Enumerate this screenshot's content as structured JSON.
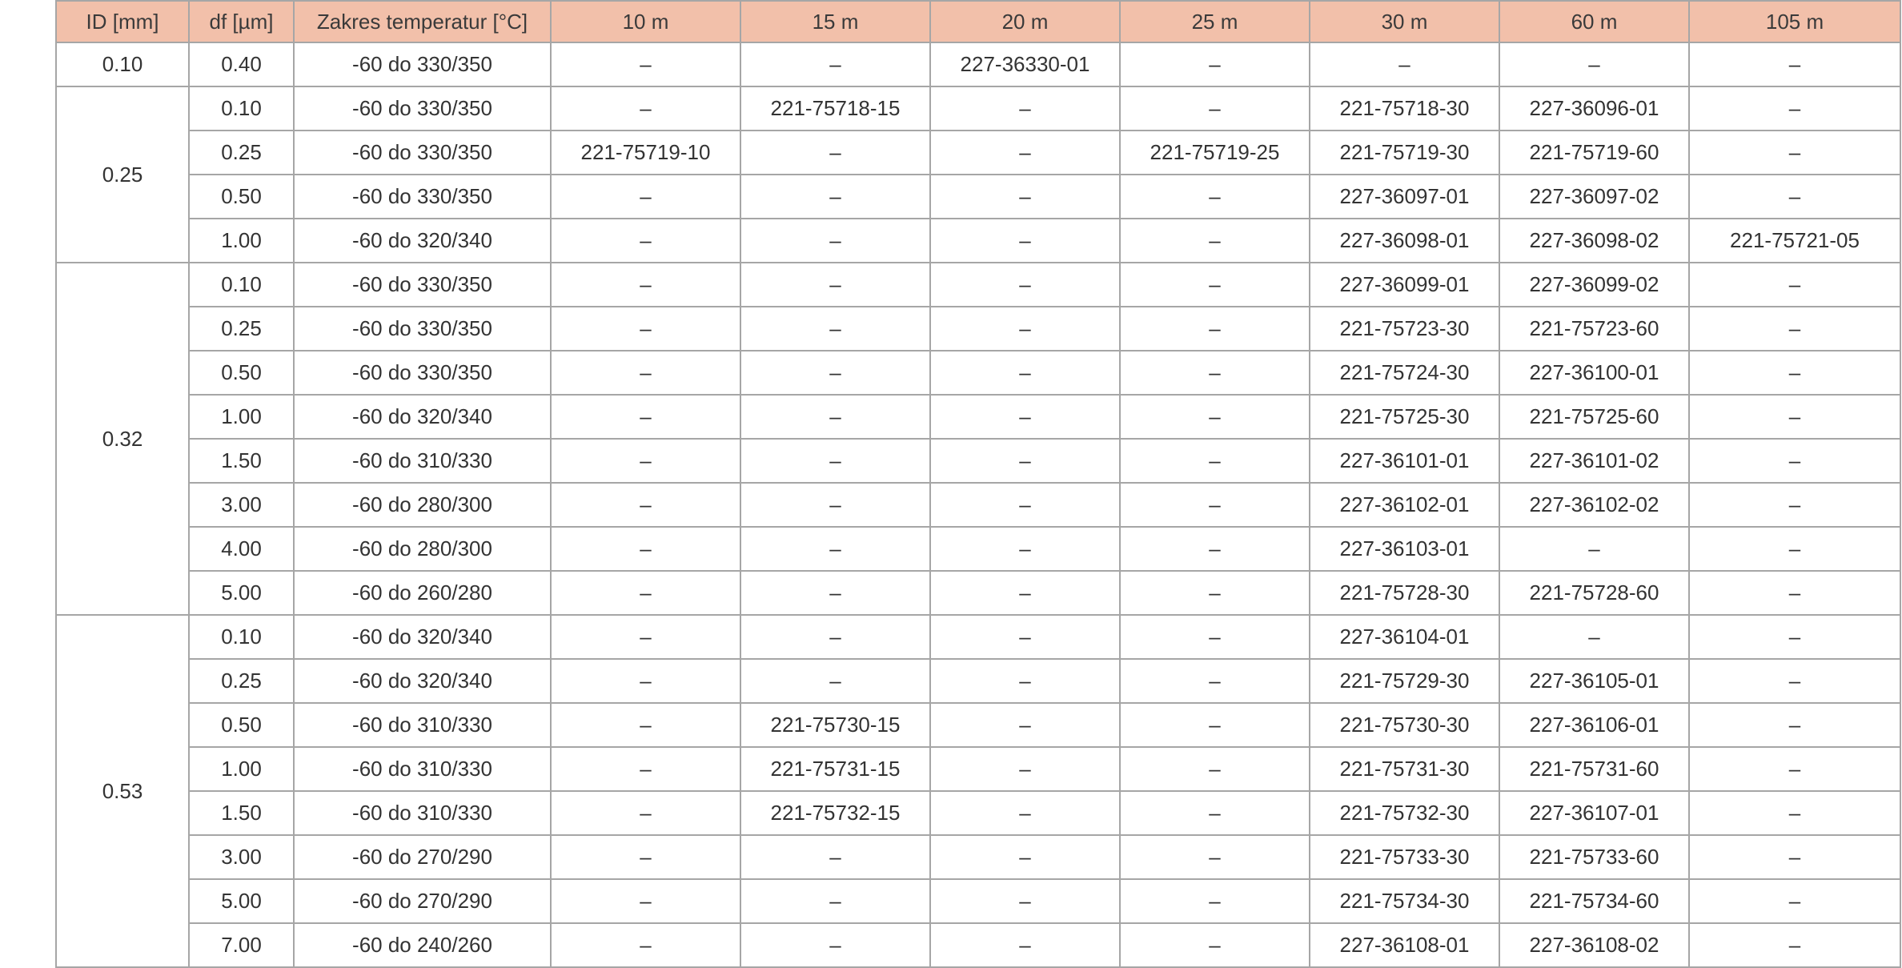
{
  "table": {
    "header_bg": "#f2c0aa",
    "border_color": "#a6a6a6",
    "headers": [
      "ID [mm]",
      "df [µm]",
      "Zakres temperatur [°C]",
      "10 m",
      "15 m",
      "20 m",
      "25 m",
      "30 m",
      "60 m",
      "105 m"
    ],
    "groups": [
      {
        "id": "0.10",
        "rows": [
          [
            "0.40",
            "-60 do 330/350",
            "–",
            "–",
            "227-36330-01",
            "–",
            "–",
            "–",
            "–"
          ]
        ]
      },
      {
        "id": "0.25",
        "rows": [
          [
            "0.10",
            "-60 do 330/350",
            "–",
            "221-75718-15",
            "–",
            "–",
            "221-75718-30",
            "227-36096-01",
            "–"
          ],
          [
            "0.25",
            "-60 do 330/350",
            "221-75719-10",
            "–",
            "–",
            "221-75719-25",
            "221-75719-30",
            "221-75719-60",
            "–"
          ],
          [
            "0.50",
            "-60 do 330/350",
            "–",
            "–",
            "–",
            "–",
            "227-36097-01",
            "227-36097-02",
            "–"
          ],
          [
            "1.00",
            "-60 do 320/340",
            "–",
            "–",
            "–",
            "–",
            "227-36098-01",
            "227-36098-02",
            "221-75721-05"
          ]
        ]
      },
      {
        "id": "0.32",
        "rows": [
          [
            "0.10",
            "-60 do 330/350",
            "–",
            "–",
            "–",
            "–",
            "227-36099-01",
            "227-36099-02",
            "–"
          ],
          [
            "0.25",
            "-60 do 330/350",
            "–",
            "–",
            "–",
            "–",
            "221-75723-30",
            "221-75723-60",
            "–"
          ],
          [
            "0.50",
            "-60 do 330/350",
            "–",
            "–",
            "–",
            "–",
            "221-75724-30",
            "227-36100-01",
            "–"
          ],
          [
            "1.00",
            "-60 do 320/340",
            "–",
            "–",
            "–",
            "–",
            "221-75725-30",
            "221-75725-60",
            "–"
          ],
          [
            "1.50",
            "-60 do 310/330",
            "–",
            "–",
            "–",
            "–",
            "227-36101-01",
            "227-36101-02",
            "–"
          ],
          [
            "3.00",
            "-60 do 280/300",
            "–",
            "–",
            "–",
            "–",
            "227-36102-01",
            "227-36102-02",
            "–"
          ],
          [
            "4.00",
            "-60 do 280/300",
            "–",
            "–",
            "–",
            "–",
            "227-36103-01",
            "–",
            "–"
          ],
          [
            "5.00",
            "-60 do 260/280",
            "–",
            "–",
            "–",
            "–",
            "221-75728-30",
            "221-75728-60",
            "–"
          ]
        ]
      },
      {
        "id": "0.53",
        "rows": [
          [
            "0.10",
            "-60 do 320/340",
            "–",
            "–",
            "–",
            "–",
            "227-36104-01",
            "–",
            "–"
          ],
          [
            "0.25",
            "-60 do 320/340",
            "–",
            "–",
            "–",
            "–",
            "221-75729-30",
            "227-36105-01",
            "–"
          ],
          [
            "0.50",
            "-60 do 310/330",
            "–",
            "221-75730-15",
            "–",
            "–",
            "221-75730-30",
            "227-36106-01",
            "–"
          ],
          [
            "1.00",
            "-60 do 310/330",
            "–",
            "221-75731-15",
            "–",
            "–",
            "221-75731-30",
            "221-75731-60",
            "–"
          ],
          [
            "1.50",
            "-60 do 310/330",
            "–",
            "221-75732-15",
            "–",
            "–",
            "221-75732-30",
            "227-36107-01",
            "–"
          ],
          [
            "3.00",
            "-60 do 270/290",
            "–",
            "–",
            "–",
            "–",
            "221-75733-30",
            "221-75733-60",
            "–"
          ],
          [
            "5.00",
            "-60 do 270/290",
            "–",
            "–",
            "–",
            "–",
            "221-75734-30",
            "221-75734-60",
            "–"
          ],
          [
            "7.00",
            "-60 do 240/260",
            "–",
            "–",
            "–",
            "–",
            "227-36108-01",
            "227-36108-02",
            "–"
          ]
        ]
      }
    ]
  }
}
